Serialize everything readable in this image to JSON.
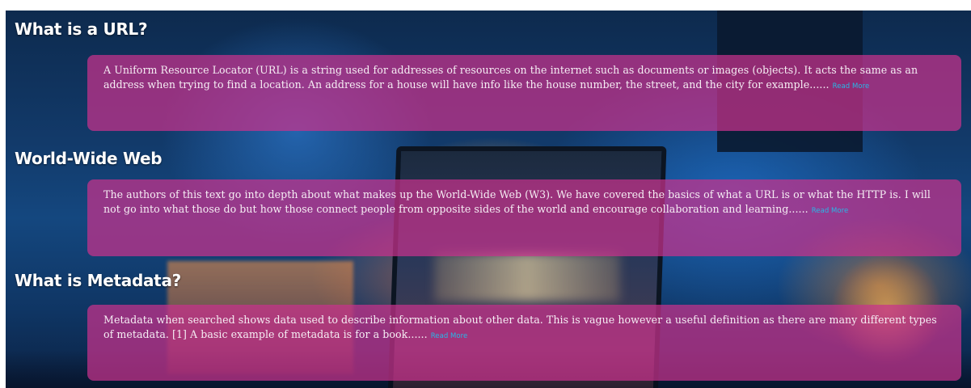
{
  "sections": [
    {
      "heading": "What is a URL?",
      "body": "A Uniform Resource Locator (URL) is a string used for addresses of resources on the internet such as documents or images (objects). It acts the same as an address when trying to find a location. An address for a house will have info like the house number, the street, and the city for example......",
      "read_more": "Read More"
    },
    {
      "heading": "World-Wide Web",
      "body": "The authors of this text go into depth about what makes up the World-Wide Web (W3). We have covered the basics of what a URL is or what the HTTP is. I will not go into what those do but how those connect people from opposite sides of the world and encourage collaboration and learning......",
      "read_more": "Read More"
    },
    {
      "heading": "What is Metadata?",
      "body": "Metadata when searched shows data used to describe information about other data. This is vague however a useful definition as there are many different types of metadata. [1] A basic example of metadata is for a book......",
      "read_more": "Read More"
    }
  ],
  "colors": {
    "card_background": "#c8328c",
    "link": "#27b8e8",
    "heading": "#ffffff"
  }
}
